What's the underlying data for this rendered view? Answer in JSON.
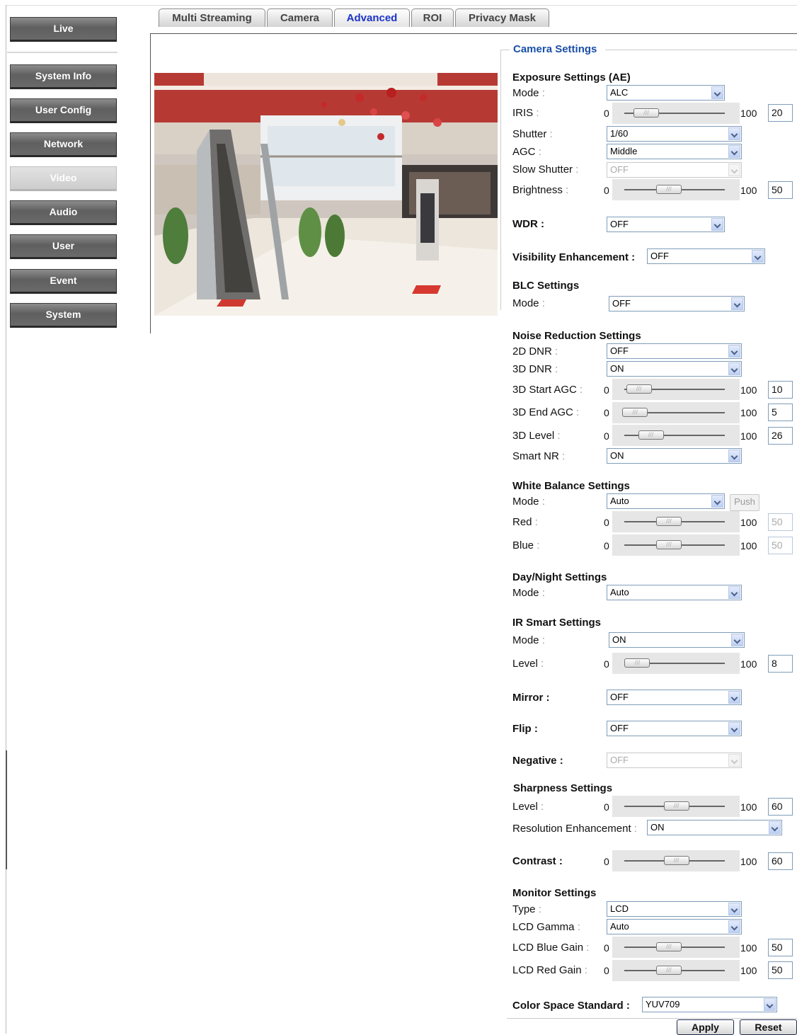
{
  "nav": {
    "live": "Live",
    "items": [
      "System Info",
      "User Config",
      "Network",
      "Video",
      "Audio",
      "User",
      "Event",
      "System"
    ]
  },
  "tabs": [
    "Multi Streaming",
    "Camera",
    "Advanced",
    "ROI",
    "Privacy Mask"
  ],
  "active_tab": "Advanced",
  "camera_settings": {
    "legend": "Camera Settings",
    "exposure": {
      "title": "Exposure Settings (AE)",
      "mode_label": "Mode",
      "mode": "ALC",
      "iris_label": "IRIS",
      "iris": "20",
      "shutter_label": "Shutter",
      "shutter": "1/60",
      "agc_label": "AGC",
      "agc": "Middle",
      "slow_shutter_label": "Slow Shutter",
      "slow_shutter": "OFF",
      "brightness_label": "Brightness",
      "brightness": "50"
    },
    "wdr": {
      "label": "WDR :",
      "value": "OFF"
    },
    "visibility": {
      "label": "Visibility Enhancement :",
      "value": "OFF"
    },
    "blc": {
      "title": "BLC Settings",
      "mode_label": "Mode",
      "mode": "OFF"
    },
    "noise": {
      "title": "Noise Reduction Settings",
      "dnr2d_label": "2D DNR",
      "dnr2d": "OFF",
      "dnr3d_label": "3D DNR",
      "dnr3d": "ON",
      "start_agc_label": "3D Start AGC",
      "start_agc": "10",
      "end_agc_label": "3D End AGC",
      "end_agc": "5",
      "level_label": "3D Level",
      "level": "26",
      "smart_nr_label": "Smart NR",
      "smart_nr": "ON"
    },
    "wb": {
      "title": "White Balance Settings",
      "mode_label": "Mode",
      "mode": "Auto",
      "push": "Push",
      "red_label": "Red",
      "red": "50",
      "blue_label": "Blue",
      "blue": "50"
    },
    "daynight": {
      "title": "Day/Night Settings",
      "mode_label": "Mode",
      "mode": "Auto"
    },
    "ir": {
      "title": "IR Smart Settings",
      "mode_label": "Mode",
      "mode": "ON",
      "level_label": "Level",
      "level": "8"
    },
    "mirror": {
      "label": "Mirror :",
      "value": "OFF"
    },
    "flip": {
      "label": "Flip :",
      "value": "OFF"
    },
    "negative": {
      "label": "Negative :",
      "value": "OFF"
    },
    "sharpness": {
      "title": "Sharpness Settings",
      "level_label": "Level",
      "level": "60",
      "res_label": "Resolution Enhancement",
      "res": "ON"
    },
    "contrast": {
      "label": "Contrast :",
      "value": "60"
    },
    "monitor": {
      "title": "Monitor Settings",
      "type_label": "Type",
      "type": "LCD",
      "gamma_label": "LCD Gamma",
      "gamma": "Auto",
      "blue_gain_label": "LCD Blue Gain",
      "blue_gain": "50",
      "red_gain_label": "LCD Red Gain",
      "red_gain": "50"
    },
    "color_space": {
      "label": "Color Space Standard :",
      "value": "YUV709"
    },
    "slider_min": "0",
    "slider_max": "100",
    "slider_grip": "///"
  },
  "actions": {
    "apply": "Apply",
    "reset": "Reset"
  }
}
